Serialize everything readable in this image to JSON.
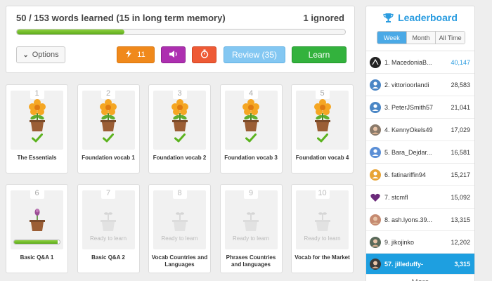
{
  "progress": {
    "words_text": "50 / 153 words learned (15 in long term memory)",
    "ignored_text": "1 ignored",
    "fraction": 0.327
  },
  "toolbar": {
    "options_label": "Options",
    "speed_count": "11",
    "review_label": "Review (35)",
    "learn_label": "Learn"
  },
  "levels": [
    {
      "num": "1",
      "title": "The Essentials",
      "state": "complete"
    },
    {
      "num": "2",
      "title": "Foundation vocab 1",
      "state": "complete"
    },
    {
      "num": "3",
      "title": "Foundation vocab 2",
      "state": "complete"
    },
    {
      "num": "4",
      "title": "Foundation vocab 3",
      "state": "complete"
    },
    {
      "num": "5",
      "title": "Foundation vocab 4",
      "state": "complete"
    },
    {
      "num": "6",
      "title": "Basic Q&A 1",
      "state": "in-progress",
      "progress": 0.95
    },
    {
      "num": "7",
      "title": "Basic Q&A 2",
      "state": "locked",
      "ready": "Ready to learn"
    },
    {
      "num": "8",
      "title": "Vocab Countries and Languages",
      "state": "locked",
      "ready": "Ready to learn"
    },
    {
      "num": "9",
      "title": "Phrases Countries and languages",
      "state": "locked",
      "ready": "Ready to learn"
    },
    {
      "num": "10",
      "title": "Vocab for the Market",
      "state": "locked",
      "ready": "Ready to learn"
    }
  ],
  "leaderboard": {
    "title": "Leaderboard",
    "tabs": [
      "Week",
      "Month",
      "All Time"
    ],
    "active_tab": "Week",
    "rows": [
      {
        "rank_name": "1. MacedoniaB...",
        "score": "40,147",
        "avatar": "dark-logo",
        "color": "#222222"
      },
      {
        "rank_name": "2. vittorioorlandi",
        "score": "28,583",
        "avatar": "default-user",
        "color": "#4a86c5"
      },
      {
        "rank_name": "3. PeterJSmith57",
        "score": "21,041",
        "avatar": "default-user",
        "color": "#4a86c5"
      },
      {
        "rank_name": "4. KennyOkels49",
        "score": "17,029",
        "avatar": "photo",
        "color": "#8a7a6a"
      },
      {
        "rank_name": "5. Bara_Dejdar...",
        "score": "16,581",
        "avatar": "default-user",
        "color": "#5b8fd6"
      },
      {
        "rank_name": "6. fatinariffin94",
        "score": "15,217",
        "avatar": "default-user",
        "color": "#e8a436"
      },
      {
        "rank_name": "7. stcmfl",
        "score": "15,092",
        "avatar": "heart",
        "color": "#6b2a7a"
      },
      {
        "rank_name": "8. ash.lyons.39...",
        "score": "13,315",
        "avatar": "photo",
        "color": "#c58a70"
      },
      {
        "rank_name": "9. jikojinko",
        "score": "12,202",
        "avatar": "photo",
        "color": "#5a6a5a"
      }
    ],
    "me": {
      "rank_name": "57. jilleduffy-",
      "score": "3,315",
      "avatar": "photo",
      "color": "#3a3a3a"
    },
    "more_label": "More"
  },
  "colors": {
    "accent": "#2a9ce0",
    "learn": "#33b23d",
    "review": "#83c7f2",
    "speed": "#f0891b",
    "audio": "#ad2fb0",
    "timer": "#ee5a35"
  }
}
